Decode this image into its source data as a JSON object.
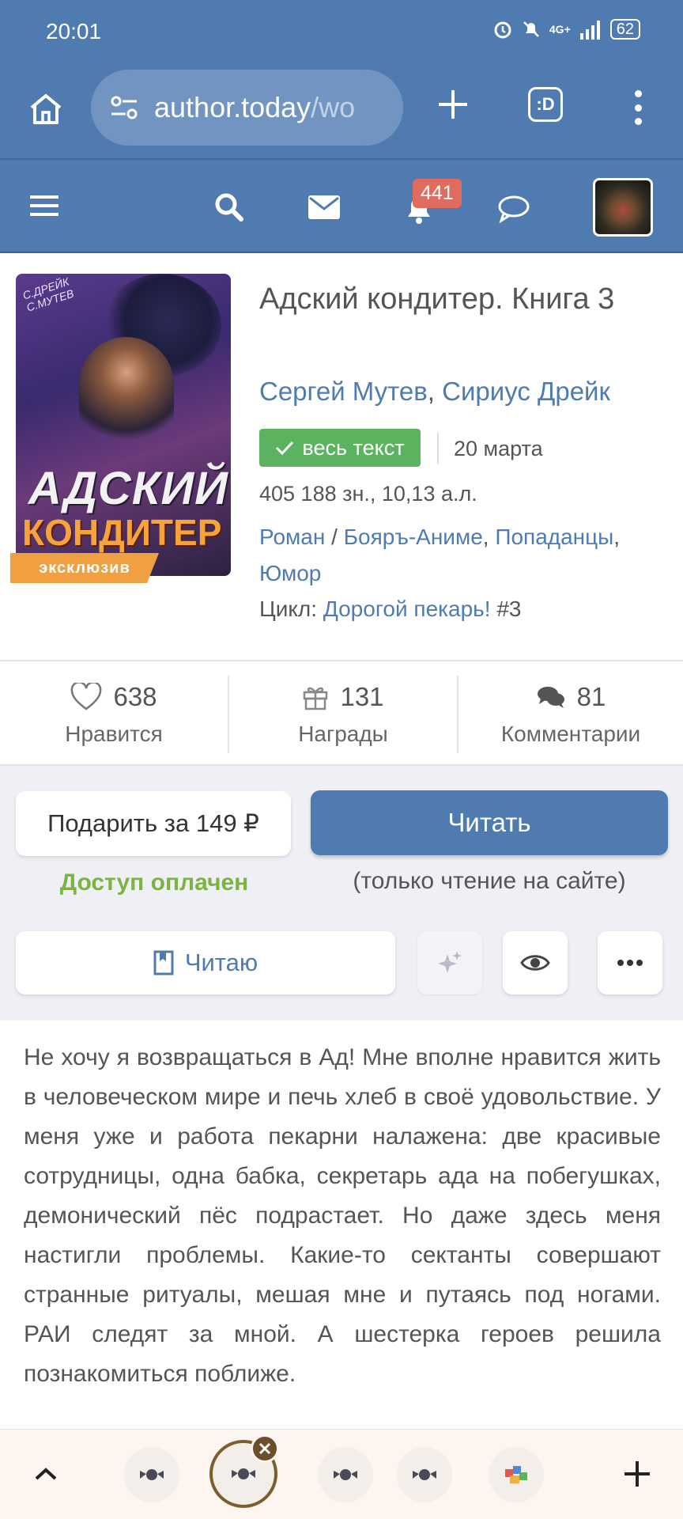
{
  "status_bar": {
    "time": "20:01",
    "network": "4G+",
    "battery": "62"
  },
  "browser": {
    "url_main": "author.today",
    "url_path": "/wo",
    "tabs_icon_label": ":D",
    "icons": [
      "home-icon",
      "site-settings-icon",
      "new-tab-plus-icon",
      "tab-switcher-icon",
      "overflow-menu-icon"
    ]
  },
  "site_nav": {
    "notifications_count": "441",
    "icons": [
      "menu-icon",
      "search-icon",
      "mail-icon",
      "bell-icon",
      "chat-bubble-icon",
      "user-avatar"
    ]
  },
  "book": {
    "cover": {
      "authors_line1": "С.ДРЕЙК",
      "authors_line2": "С.МУТЕВ",
      "title_line1": "АДСКИЙ",
      "title_line2": "КОНДИТЕР"
    },
    "badge": "эксклюзив",
    "title": "Адский кондитер. Книга 3",
    "authors": [
      "Сергей Мутев",
      "Сириус Дрейк"
    ],
    "author_separator": ",",
    "status_label": "весь текст",
    "date": "20 марта",
    "size": "405 188 зн., 10,13 а.л.",
    "genre_main": "Роман",
    "genre_slash": "/",
    "genres": [
      "Бояръ-Аниме",
      "Попаданцы",
      "Юмор"
    ],
    "series_prefix": "Цикл:",
    "series_name": "Дорогой пекарь!",
    "series_number": "#3"
  },
  "stats": {
    "likes": {
      "count": "638",
      "label": "Нравится"
    },
    "awards": {
      "count": "131",
      "label": "Награды"
    },
    "comments": {
      "count": "81",
      "label": "Комментарии"
    }
  },
  "actions": {
    "gift_label": "Подарить за 149 ₽",
    "read_label": "Читать",
    "paid_label": "Доступ оплачен",
    "read_note": "(только чтение на сайте)",
    "reading_label": "Читаю"
  },
  "description": "Не хочу я возвращаться в Ад! Мне вполне нравится жить в человеческом мире и печь хлеб в своё удовольствие. У меня уже и работа пекарни налажена: две красивые сотрудницы, одна бабка, секретарь ада на побегушках, демонический пёс подрастает. Но даже здесь меня настигли проблемы. Какие-то сектанты совершают странные ритуалы, мешая мне и путаясь под ногами. РАИ следят за мной. А шестерка героев решила познакомиться поближе.",
  "colors": {
    "brand_blue": "#4f7bb0",
    "success_green": "#5bb35f",
    "paid_green": "#7cb342",
    "badge_red": "#e06b5f",
    "exclusive_orange": "#f0a040"
  }
}
